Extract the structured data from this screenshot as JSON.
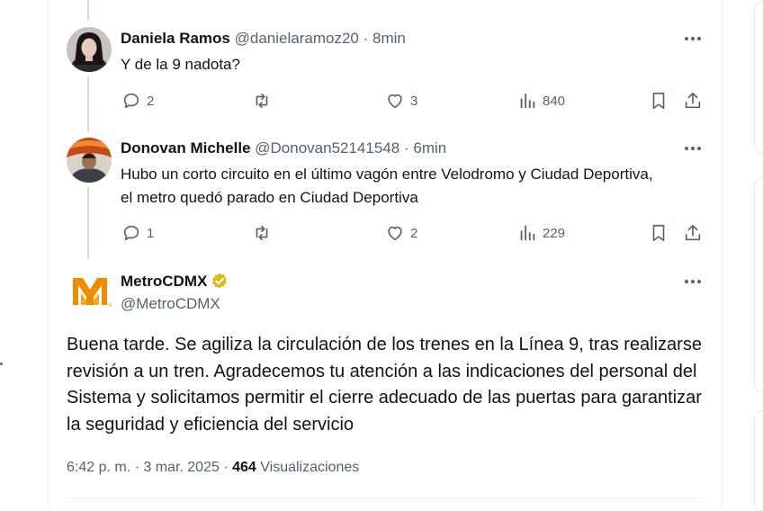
{
  "replies": [
    {
      "name": "Daniela Ramos",
      "handle": "@danielaramoz20",
      "sep": "·",
      "time": "8min",
      "text": "Y de la 9 nadota?",
      "replies_count": "2",
      "likes_count": "3",
      "views_count": "840"
    },
    {
      "name": "Donovan Michelle",
      "handle": "@Donovan52141548",
      "sep": "·",
      "time": "6min",
      "text": "Hubo un corto circuito en el último vagón entre Velodromo y Ciudad Deportiva, el metro quedó parado en Ciudad Deportiva",
      "replies_count": "1",
      "likes_count": "2",
      "views_count": "229"
    }
  ],
  "main_post": {
    "name": "MetroCDMX",
    "handle": "@MetroCDMX",
    "text": "Buena tarde. Se agiliza la circulación de los trenes en la Línea 9, tras realizarse revisión a un tren. Agradecemos tu atención a las indicaciones del personal del Sistema y solicitamos permitir el cierre adecuado de las puertas para garantizar la seguridad y eficiencia del servicio",
    "timestamp": "6:42 p. m. · 3 mar. 2025 ·",
    "views_count": "464",
    "views_label": "Visualizaciones",
    "verified_color": "#e2b719",
    "logo_color": "#f08c00"
  },
  "icons": {
    "more": "more-horizontal-icon",
    "reply": "reply-icon",
    "repost": "repost-icon",
    "like": "like-icon",
    "views": "views-icon",
    "bookmark": "bookmark-icon",
    "share": "share-icon",
    "verified": "verified-badge-icon"
  },
  "colors": {
    "text": "#0f1419",
    "muted": "#536471",
    "thread_line": "#cfd9de"
  }
}
